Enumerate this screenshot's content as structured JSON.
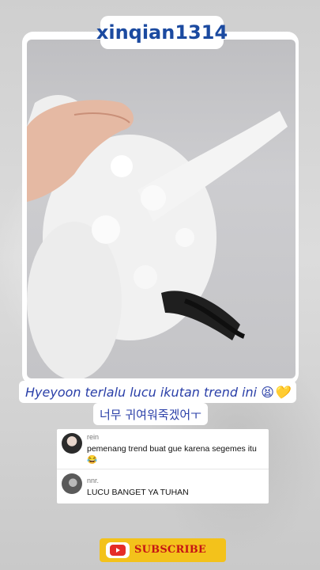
{
  "header": {
    "username": "xinqian1314"
  },
  "video": {
    "caption_line1": "Hyeyoon terlalu lucu ikutan trend ini 😫💛",
    "caption_line2": "너무 귀여워죽겠어ㅜ"
  },
  "comments": [
    {
      "handle": "rein",
      "text": "pemenang trend buat gue karena segemes itu 😂",
      "avatar": "avatar-photo"
    },
    {
      "handle": "nnr.",
      "text": "LUCU BANGET YA TUHAN",
      "avatar": "avatar-photo"
    }
  ],
  "subscribe": {
    "label": "SUBSCRIBE",
    "icon": "youtube-play-icon"
  },
  "colors": {
    "caption_text": "#2a3fa8",
    "username_text": "#1b4aa0",
    "subscribe_bg": "#f3c21b",
    "subscribe_text": "#c61414"
  }
}
